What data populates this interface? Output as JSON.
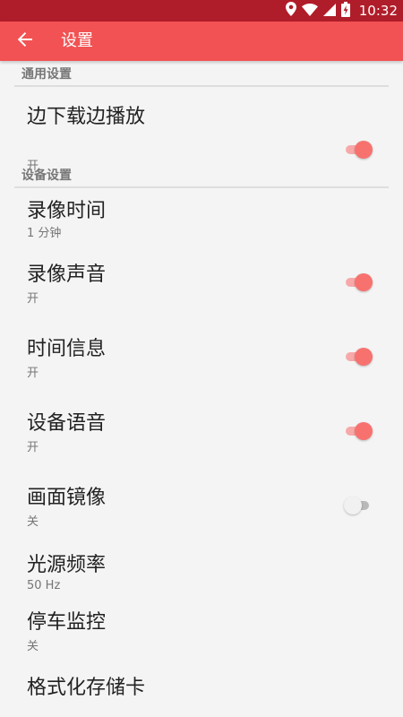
{
  "status_bar": {
    "time": "10:32",
    "icons": [
      "location-icon",
      "wifi-icon",
      "cell-signal-icon",
      "battery-charging-icon"
    ]
  },
  "app_bar": {
    "back_icon": "arrow-back-icon",
    "title": "设置"
  },
  "categories": {
    "general": {
      "label": "通用设置"
    },
    "device": {
      "label": "设备设置"
    }
  },
  "preferences": {
    "play_while_download": {
      "title": "边下载边播放",
      "summary": "开",
      "switch": "on"
    },
    "record_time": {
      "title": "录像时间",
      "summary": "1 分钟"
    },
    "record_audio": {
      "title": "录像声音",
      "summary": "开",
      "switch": "on"
    },
    "time_info": {
      "title": "时间信息",
      "summary": "开",
      "switch": "on"
    },
    "device_voice": {
      "title": "设备语音",
      "summary": "开",
      "switch": "on"
    },
    "mirror_image": {
      "title": "画面镜像",
      "summary": "关",
      "switch": "off"
    },
    "light_frequency": {
      "title": "光源频率",
      "summary": "50 Hz"
    },
    "parking_monitor": {
      "title": "停车监控",
      "summary": "关"
    },
    "format_sd": {
      "title": "格式化存储卡"
    }
  },
  "colors": {
    "status_bar": "#b01d2a",
    "app_bar": "#f25253",
    "accent": "#f7726f",
    "background": "#f4f4f4"
  }
}
